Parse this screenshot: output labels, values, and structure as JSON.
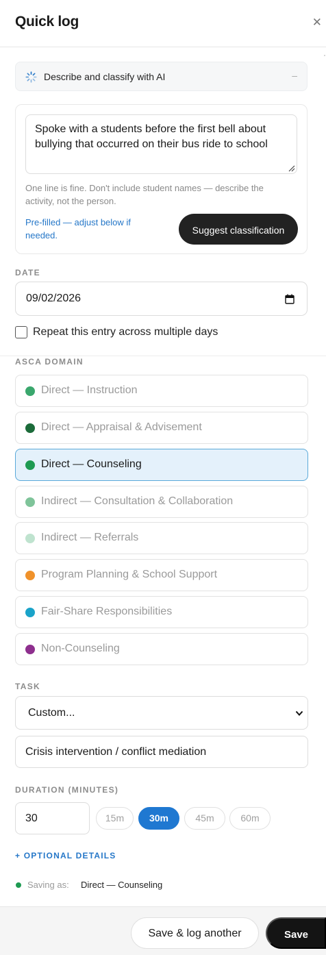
{
  "header": {
    "title": "Quick log",
    "close_icon": "close-icon"
  },
  "ai": {
    "bar_label": "Describe and classify with AI",
    "collapse_symbol": "–",
    "description": "Spoke with a students before the first bell about bullying that occurred on their bus ride to school",
    "hint": "One line is fine. Don't include student names — describe the activity, not the person.",
    "prefilled_note": "Pre-filled — adjust below if needed.",
    "suggest_label": "Suggest classification"
  },
  "date": {
    "label": "DATE",
    "value": "09/02/2026",
    "icon": "calendar-icon"
  },
  "repeat": {
    "label": "Repeat this entry across multiple days",
    "checked": false
  },
  "domain": {
    "label": "ASCA DOMAIN",
    "options": [
      {
        "label": "Direct — Instruction",
        "color": "#3aa76d",
        "selected": false
      },
      {
        "label": "Direct — Appraisal & Advisement",
        "color": "#1c6b3a",
        "selected": false
      },
      {
        "label": "Direct — Counseling",
        "color": "#1e9a52",
        "selected": true
      },
      {
        "label": "Indirect — Consultation & Collaboration",
        "color": "#7fc49a",
        "selected": false
      },
      {
        "label": "Indirect — Referrals",
        "color": "#bfe3cf",
        "selected": false
      },
      {
        "label": "Program Planning & School Support",
        "color": "#f0922b",
        "selected": false
      },
      {
        "label": "Fair-Share Responsibilities",
        "color": "#1aa3c9",
        "selected": false
      },
      {
        "label": "Non-Counseling",
        "color": "#8e2f8e",
        "selected": false
      }
    ]
  },
  "task": {
    "label": "TASK",
    "selected": "Custom...",
    "custom_value": "Crisis intervention / conflict mediation"
  },
  "duration": {
    "label": "DURATION (MINUTES)",
    "value": "30",
    "presets": [
      {
        "label": "15m",
        "active": false
      },
      {
        "label": "30m",
        "active": true
      },
      {
        "label": "45m",
        "active": false
      },
      {
        "label": "60m",
        "active": false
      }
    ]
  },
  "optional_details": "+ OPTIONAL DETAILS",
  "saving": {
    "label": "Saving as:",
    "value": "Direct — Counseling",
    "color": "#1e9a52"
  },
  "footer": {
    "secondary_label": "Save & log another",
    "primary_label": "Save"
  },
  "colors": {
    "accent": "#1f78d1",
    "selected_bg": "#e4f1fb",
    "primary_button": "#141414"
  }
}
